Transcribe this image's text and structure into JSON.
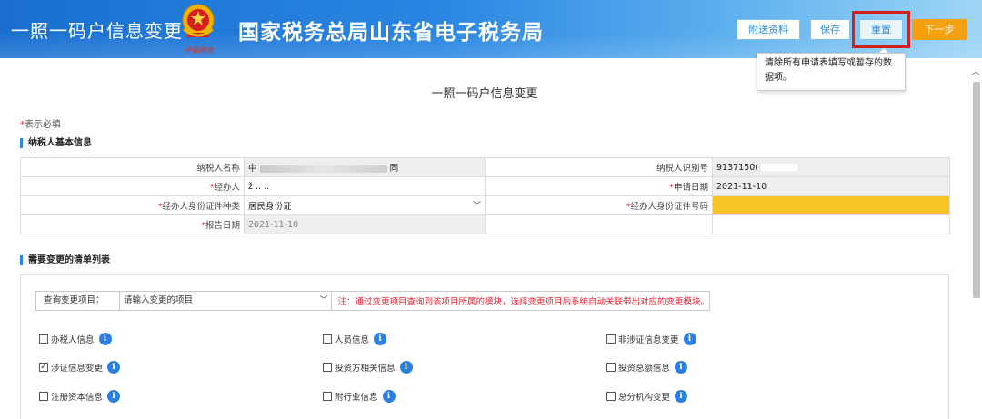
{
  "header": {
    "system_title": "一照一码户信息变更",
    "emblem_text": "中国税务",
    "bureau_title": "国家税务总局山东省电子税务局",
    "buttons": {
      "attach": "附送资料",
      "save": "保存",
      "reset": "重置",
      "next": "下一步"
    },
    "tooltip": "清除所有申请表填写或暂存的数据项。"
  },
  "page": {
    "heading": "一照一码户信息变更",
    "required_star": "*",
    "required_note": "表示必填"
  },
  "basic_info": {
    "section_title": "纳税人基本信息",
    "taxpayer_name_label": "纳税人名称",
    "taxpayer_name_prefix": "中",
    "taxpayer_name_suffix": "同",
    "taxpayer_id_label": "纳税人识别号",
    "taxpayer_id_value": "9137150(",
    "agent_label": "经办人",
    "agent_value": "ž ..  ..",
    "apply_date_label": "申请日期",
    "apply_date_value": "2021-11-10",
    "id_type_label": "经办人身份证件种类",
    "id_type_value": "居民身份证",
    "id_number_label": "经办人身份证件号码",
    "id_number_value": "",
    "report_date_label": "报告日期",
    "report_date_value": "2021-11-10",
    "star": "*"
  },
  "change_list": {
    "section_title": "需要变更的清单列表",
    "query_label": "查询变更项目：",
    "query_placeholder": "请输入变更的项目",
    "query_note": "注：通过变更项目查询到该项目所属的模块，选择变更项目后系统自动关联带出对应的变更模块。",
    "info_glyph": "i",
    "check_glyph": "✓",
    "items": [
      {
        "label": "办税人信息",
        "checked": false
      },
      {
        "label": "人员信息",
        "checked": false
      },
      {
        "label": "非涉证信息变更",
        "checked": false
      },
      {
        "label": "涉证信息变更",
        "checked": true
      },
      {
        "label": "投资方相关信息",
        "checked": false
      },
      {
        "label": "投资总额信息",
        "checked": false
      },
      {
        "label": "注册资本信息",
        "checked": false
      },
      {
        "label": "附行业信息",
        "checked": false
      },
      {
        "label": "总分机构变更",
        "checked": false
      }
    ]
  },
  "colors": {
    "header_blue": "#1a6fd0",
    "next_orange": "#f5a011",
    "highlight_red": "#d41f1f",
    "required_red": "#e23",
    "id_field_yellow": "#f7c326",
    "info_icon_blue": "#2a7fe0"
  }
}
